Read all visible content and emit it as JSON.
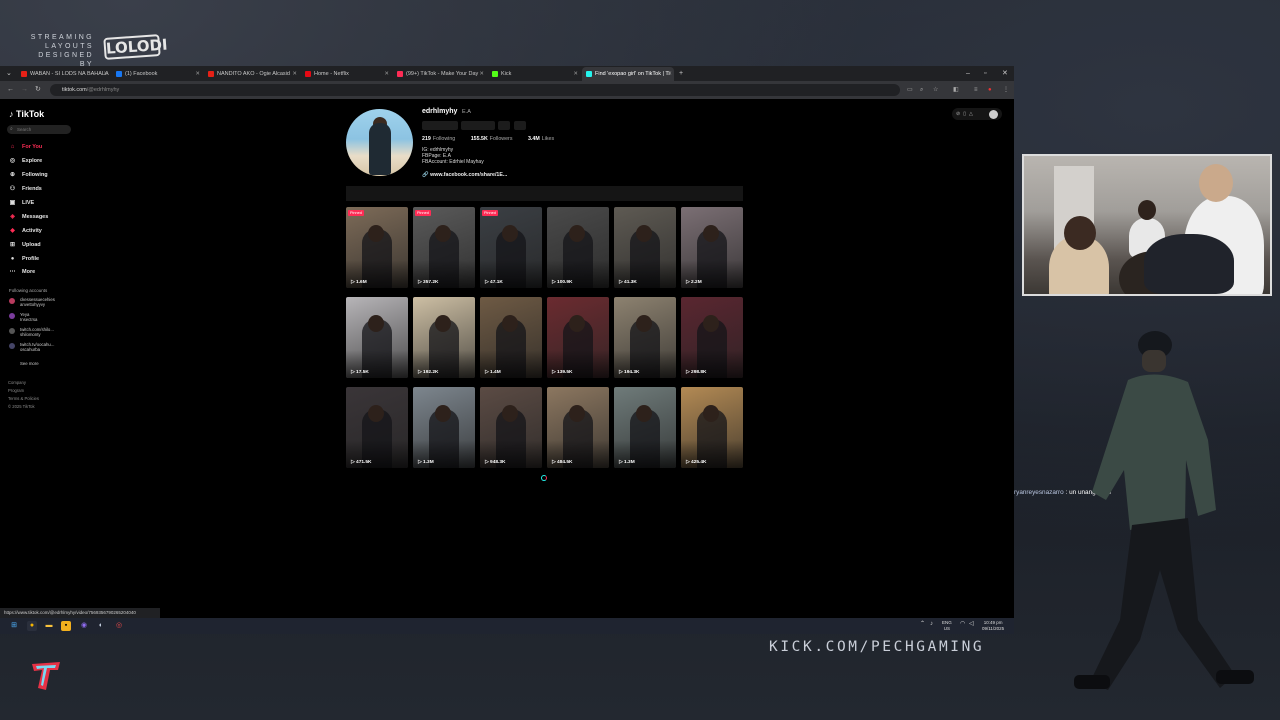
{
  "overlay": {
    "layout_credit": [
      "STREAMING",
      "LAYOUTS",
      "DESIGNED BY"
    ],
    "brand_logo": "LOLODI",
    "kick_url": "KICK.COM/PECHGAMING",
    "chat": {
      "user": "ryanreyesnazarro",
      "message": ": un unang vid p"
    }
  },
  "browser": {
    "tabs": [
      {
        "title": "WABAN - SI LODS NA BAHALA",
        "color": "#e62117"
      },
      {
        "title": "(1) Facebook",
        "color": "#1877f2"
      },
      {
        "title": "NANDITO AKO - Ogie Alcasid",
        "color": "#e62117"
      },
      {
        "title": "Home - Netflix",
        "color": "#e50914"
      },
      {
        "title": "(99+) TikTok - Make Your Day",
        "color": "#fe2c55"
      },
      {
        "title": "Kick",
        "color": "#53fc18"
      },
      {
        "title": "Find 'exopao girl' on TikTok | Ti",
        "color": "#25f4ee",
        "active": true
      }
    ],
    "url_host": "tiktok.com",
    "url_path": "/@edrhlmyhy",
    "status_url": "https://www.tiktok.com/@edrhlmyhy/video/7569356790265204040"
  },
  "tiktok": {
    "logo": "TikTok",
    "search_placeholder": "Search",
    "nav": [
      {
        "label": "For You",
        "icon": "home-icon"
      },
      {
        "label": "Explore",
        "icon": "compass-icon"
      },
      {
        "label": "Following",
        "icon": "following-icon"
      },
      {
        "label": "Friends",
        "icon": "friends-icon"
      },
      {
        "label": "LIVE",
        "icon": "live-icon"
      },
      {
        "label": "Messages",
        "icon": "messages-icon"
      },
      {
        "label": "Activity",
        "icon": "activity-icon"
      },
      {
        "label": "Upload",
        "icon": "upload-icon"
      },
      {
        "label": "Profile",
        "icon": "profile-icon"
      },
      {
        "label": "More",
        "icon": "more-icon"
      }
    ],
    "following_title": "Following accounts",
    "following": [
      {
        "name": "ckessessuecehies",
        "sub": "anvettohyyvy"
      },
      {
        "name": "Yeya",
        "sub": "Insectrsa"
      },
      {
        "name": "twitch.com/shilo...",
        "sub": "shilomonty"
      },
      {
        "name": "twitch.tv/oocahu...",
        "sub": "oscahurba"
      }
    ],
    "see_more": "See more",
    "footer": [
      "Company",
      "Program",
      "Terms & Policies",
      "© 2025 TikTok"
    ]
  },
  "profile": {
    "username": "edrhlmyhy",
    "nickname": "E.A",
    "following": "219",
    "following_label": "Following",
    "followers": "155.5K",
    "followers_label": "Followers",
    "likes": "3.4M",
    "likes_label": "Likes",
    "bio": [
      "IG: edrhlmyhy",
      "FBPage: E.A",
      "FBAccount: Edrhiel Mayhay"
    ],
    "link": "www.facebook.com/share/1E..."
  },
  "videos": [
    {
      "views": "1.6M",
      "pinned": "Pinned",
      "bg": "#7d6b58"
    },
    {
      "views": "357.2K",
      "pinned": "Pinned",
      "bg": "#5a5a5a"
    },
    {
      "views": "47.1K",
      "pinned": "Pinned",
      "bg": "#3b3f44"
    },
    {
      "views": "100.9K",
      "bg": "#4a4a4a"
    },
    {
      "views": "41.3K",
      "bg": "#5e5a53"
    },
    {
      "views": "2.2M",
      "bg": "#7b6f74"
    },
    {
      "views": "17.5K",
      "bg": "#b7b5b8"
    },
    {
      "views": "192.2K",
      "bg": "#cdbfa4"
    },
    {
      "views": "1.4M",
      "bg": "#6e5a44"
    },
    {
      "views": "139.5K",
      "bg": "#6b2b30"
    },
    {
      "views": "194.3K",
      "bg": "#8d8270"
    },
    {
      "views": "298.8K",
      "bg": "#5a2630"
    },
    {
      "views": "471.5K",
      "bg": "#3a3538"
    },
    {
      "views": "1.3M",
      "bg": "#7d868e"
    },
    {
      "views": "948.3K",
      "bg": "#5b4b44"
    },
    {
      "views": "484.5K",
      "bg": "#8c7760"
    },
    {
      "views": "1.3M",
      "bg": "#6f7b7a"
    },
    {
      "views": "425.4K",
      "bg": "#b38a54"
    }
  ],
  "taskbar": {
    "lang": "ENG",
    "region": "US",
    "time": "10:49 pm",
    "date": "09/11/2025"
  }
}
